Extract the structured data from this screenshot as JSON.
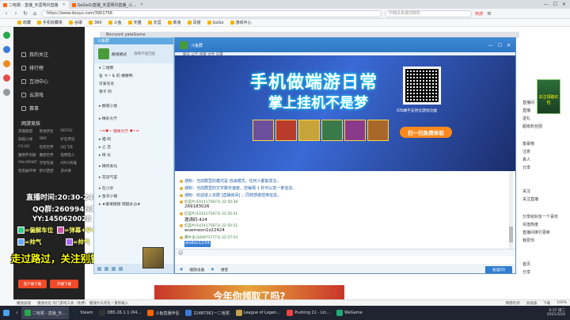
{
  "browser": {
    "tabs": [
      {
        "label": "二哈粥 - 直播_天涯明月直播",
        "active": true
      },
      {
        "label": "GeGeGi直播_天涯明月直播_斗…",
        "active": false
      }
    ],
    "url": "https://www.douyu.com/3951756",
    "search_placeholder": "中韩关系或迎转机",
    "search_tag": "热搜",
    "bookmarks": [
      "收藏",
      "手机收藏夹",
      "谷歌",
      "360",
      "斗鱼",
      "天猫",
      "天涯",
      "新浪",
      "百度",
      "GoGo",
      "游戏中心"
    ],
    "background_tab": "Bocrysnt yateGame"
  },
  "douyu_sidebar": {
    "nav": [
      "我的关注",
      "排行榜",
      "互动中心",
      "云游戏",
      "赛事"
    ],
    "section_title": "网游竞技",
    "games": [
      "英雄联盟",
      "绝地求生",
      "DOTA2",
      "穿越火线",
      "DNF",
      "炉石传说",
      "CS:GO",
      "坦克世界",
      "QQ飞车",
      "魔兽怀旧服",
      "魔兽世界",
      "怪物猎人",
      "VALORANT",
      "守望先锋",
      "APEX英雄",
      "暗黑破坏神",
      "梦幻西游",
      "逆水寒"
    ],
    "buttons": [
      "客户端下载",
      "开播下载"
    ]
  },
  "overlay": {
    "line1": "直播时间:20:30-24:00 (晚点开)",
    "line2": "QQ群:260994635",
    "line3": "YY:1450620028",
    "line4a": "=偏解车位",
    "line4b": "=弹幕+V+应援上车",
    "line5a": "=帅气",
    "line5b": "=帅气",
    "line6": "走过路过，关注别错过！"
  },
  "qq_panel": {
    "title": "斗鱼群",
    "header_left": "群组模式",
    "header_right": "群聊不能回复",
    "rows": [
      {
        "text": "▾ 二哈粥",
        "red": false
      },
      {
        "text": "吾 々~ & 的 娜娜鸭",
        "red": false
      },
      {
        "text": "可爱毛毛",
        "red": false
      },
      {
        "text": "吞子 的",
        "red": false
      },
      {
        "text": "▸ 群管小屋",
        "red": false
      },
      {
        "text": "▸ 精彩大厅",
        "red": false
      },
      {
        "text": "~=♥~ 镜禅大厅 ♥~=",
        "red": true
      },
      {
        "text": "▸ 喵 呜",
        "red": false
      },
      {
        "text": "▸ 之 恋",
        "red": false
      },
      {
        "text": "▸ 情 长",
        "red": false
      },
      {
        "text": "▸ 微风发光",
        "red": false
      },
      {
        "text": "▸ 花逗气室",
        "red": false
      },
      {
        "text": "▸ 在小亭",
        "red": false
      },
      {
        "text": "▸ 金华小铺",
        "red": false
      },
      {
        "text": "▸ ★邀请链接 隔壁永占★",
        "red": false
      }
    ]
  },
  "chat": {
    "title": "斗鱼群",
    "tools": "聊天  公告  相册  文件  设置",
    "ad_title_1": "手机做端游日常",
    "ad_title_2": "掌上挂机不是梦",
    "qr_caption": "iOS端不支持云游戏功能",
    "scan_button": "扫一扫免费体验",
    "messages": [
      {
        "kind": "sys",
        "text": "通知：当前群里的模式是 自由模式，任何人都能发言。"
      },
      {
        "kind": "sys",
        "text": "通知：当前群里的文字聊天速度，您每隔 1 秒可以发一条信息。"
      },
      {
        "kind": "sys",
        "text": "通知：欢迎进入本群 [直播房间] ，同样感谢您用信息。"
      },
      {
        "kind": "meta",
        "text": "红苕片(1414175873) 22:50:38"
      },
      {
        "kind": "body",
        "text": "269183026"
      },
      {
        "kind": "meta",
        "text": "红苕片(1414175873) 22:50:41"
      },
      {
        "kind": "body",
        "text": "邀请码:424"
      },
      {
        "kind": "meta",
        "text": "红苕片(1414175873) 22:50:51"
      },
      {
        "kind": "body",
        "text": "wuemeon1z22424"
      },
      {
        "kind": "meta",
        "text": "暴牛主(3409717773) 22:57:53"
      },
      {
        "kind": "sel",
        "text": "dodoc1234"
      }
    ],
    "footer_left_1": "播放设备",
    "footer_left_2": "语音",
    "send_label": "发送(S)"
  },
  "right_panel": {
    "texts": [
      "直播间",
      "直播",
      "送礼",
      "超级粉丝团",
      "富豪榜",
      "注意",
      "真人",
      "分享",
      "关注",
      "关注直播",
      "分享给好友一个喜欢",
      "充值热度",
      "直播间排行更新",
      "我爱你",
      "首页",
      "分享"
    ],
    "badge": "关注领取红包"
  },
  "promo_banner": "今年你领取了吗?",
  "statusbar": {
    "items": [
      "播放加速",
      "播放优化 热门游戏工具（免费） 播放片头优化 / 重新载入",
      "网络检测",
      "加速器",
      "下载",
      "100%"
    ]
  },
  "taskbar": {
    "items": [
      {
        "label": "二哈粥 - 直播_天…",
        "active": true
      },
      {
        "label": "Steam",
        "active": false
      },
      {
        "label": "OBS 26.1.1 (64…",
        "active": false
      },
      {
        "label": "斗鱼直播伴侣",
        "active": false
      },
      {
        "label": "22487361一二哈粥",
        "active": false
      },
      {
        "label": "League of Legen…",
        "active": false
      },
      {
        "label": "Pushing 21 - Lin…",
        "active": false
      },
      {
        "label": "WeGame",
        "active": false
      }
    ],
    "clock_time": "0:37 周二",
    "clock_date": "2021/3/24"
  },
  "colors": {
    "douyu_orange": "#f04a2a",
    "qq_blue": "#2f77c4",
    "overlay_yellow": "#ffff00"
  }
}
